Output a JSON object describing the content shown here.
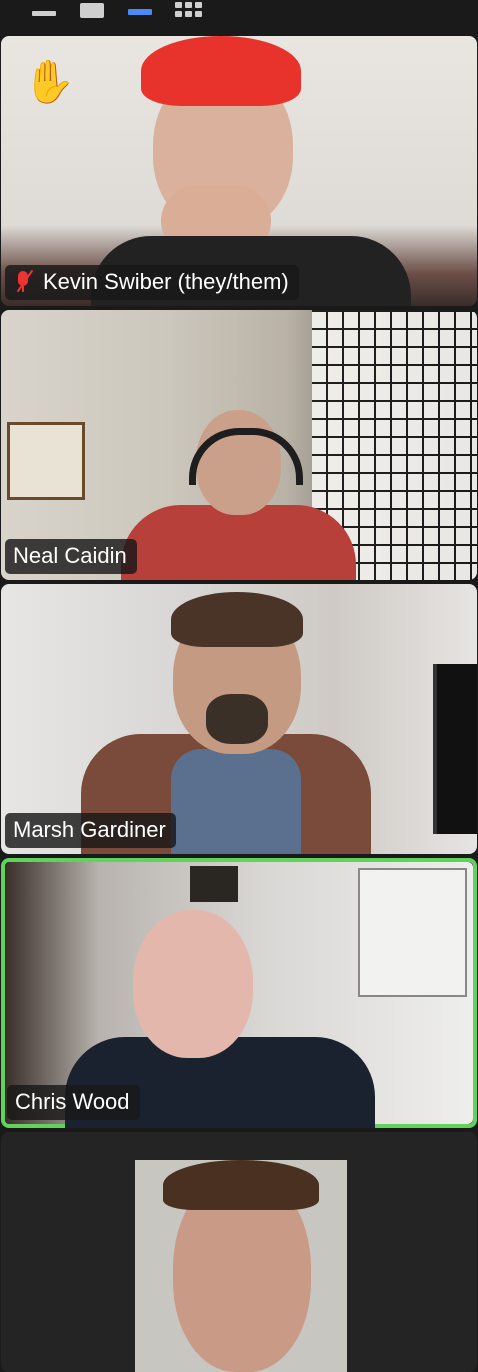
{
  "view_switcher": {
    "items": [
      {
        "id": "speaker",
        "icon": "speaker-view-icon"
      },
      {
        "id": "single",
        "icon": "single-video-icon"
      },
      {
        "id": "strip",
        "icon": "thumbnail-strip-icon",
        "selected": true
      },
      {
        "id": "gallery",
        "icon": "gallery-grid-icon"
      }
    ],
    "accent_color": "#4a8af4"
  },
  "participants": [
    {
      "name": "Kevin Swiber (they/them)",
      "muted": true,
      "raised_hand": true
    },
    {
      "name": "Neal Caidin"
    },
    {
      "name": "Marsh Gardiner"
    },
    {
      "name": "Chris Wood",
      "active_speaker": true
    },
    {
      "name": ""
    }
  ],
  "colors": {
    "active_speaker_border": "#5fd35a",
    "muted_icon": "#e33333"
  }
}
